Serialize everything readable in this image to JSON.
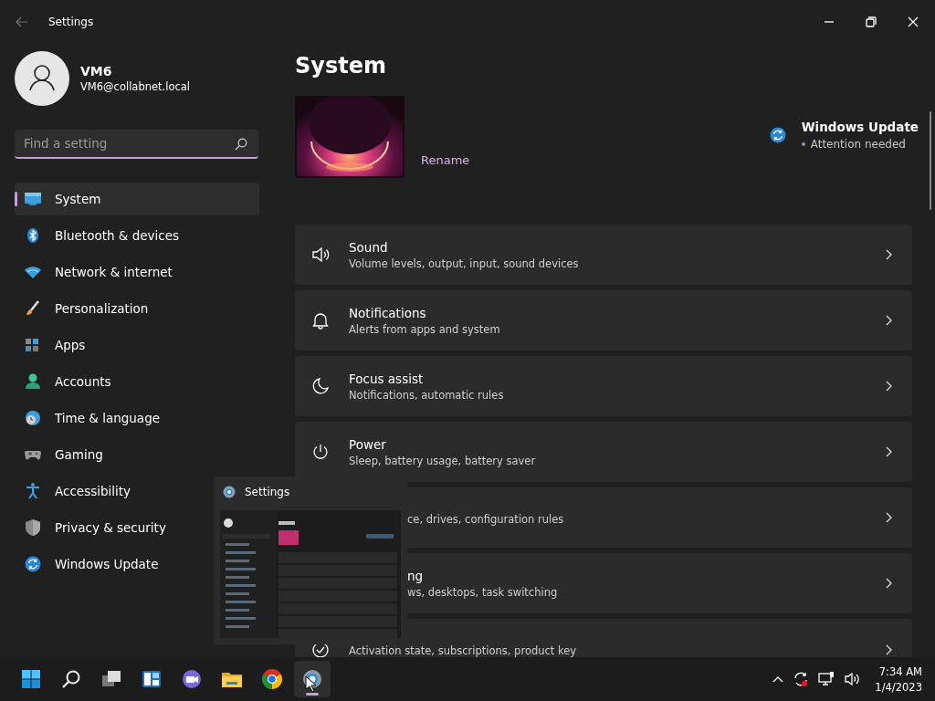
{
  "window": {
    "title": "Settings"
  },
  "profile": {
    "name": "VM6",
    "email": "VM6@collabnet.local"
  },
  "search": {
    "placeholder": "Find a setting"
  },
  "sidebar": {
    "items": [
      {
        "kind": "system",
        "label": "System",
        "selected": true
      },
      {
        "kind": "bluetooth",
        "label": "Bluetooth & devices",
        "selected": false
      },
      {
        "kind": "network",
        "label": "Network & internet",
        "selected": false
      },
      {
        "kind": "personalization",
        "label": "Personalization",
        "selected": false
      },
      {
        "kind": "apps",
        "label": "Apps",
        "selected": false
      },
      {
        "kind": "accounts",
        "label": "Accounts",
        "selected": false
      },
      {
        "kind": "time",
        "label": "Time & language",
        "selected": false
      },
      {
        "kind": "gaming",
        "label": "Gaming",
        "selected": false
      },
      {
        "kind": "accessibility",
        "label": "Accessibility",
        "selected": false
      },
      {
        "kind": "privacy",
        "label": "Privacy & security",
        "selected": false
      },
      {
        "kind": "update",
        "label": "Windows Update",
        "selected": false
      }
    ]
  },
  "page": {
    "title": "System",
    "device": {
      "kind": "picture",
      "link": "Rename"
    },
    "update": {
      "title": "Windows Update",
      "status": "Attention needed"
    }
  },
  "settings": [
    {
      "kind": "sound",
      "title": "Sound",
      "subtitle": "Volume levels, output, input, sound devices"
    },
    {
      "kind": "notifications",
      "title": "Notifications",
      "subtitle": "Alerts from apps and system"
    },
    {
      "kind": "focus",
      "title": "Focus assist",
      "subtitle": "Notifications, automatic rules"
    },
    {
      "kind": "power",
      "title": "Power",
      "subtitle": "Sleep, battery usage, battery saver"
    },
    {
      "kind": "covered",
      "subtitle": "ce, drives, configuration rules"
    },
    {
      "kind": "covered",
      "title": "ng",
      "subtitle": "ws, desktops, task switching"
    },
    {
      "kind": "activation",
      "subtitle": "Activation state, subscriptions, product key"
    }
  ],
  "preview": {
    "title": "Settings"
  },
  "taskbar": {
    "apps": [
      {
        "kind": "start",
        "selected": false
      },
      {
        "kind": "search",
        "selected": false
      },
      {
        "kind": "taskview",
        "selected": false
      },
      {
        "kind": "widgets",
        "selected": false
      },
      {
        "kind": "chat",
        "selected": false
      },
      {
        "kind": "explorer",
        "selected": false
      },
      {
        "kind": "browser",
        "selected": false
      },
      {
        "kind": "settings",
        "selected": true
      }
    ],
    "time": "7:34 AM",
    "date": "1/4/2023"
  }
}
